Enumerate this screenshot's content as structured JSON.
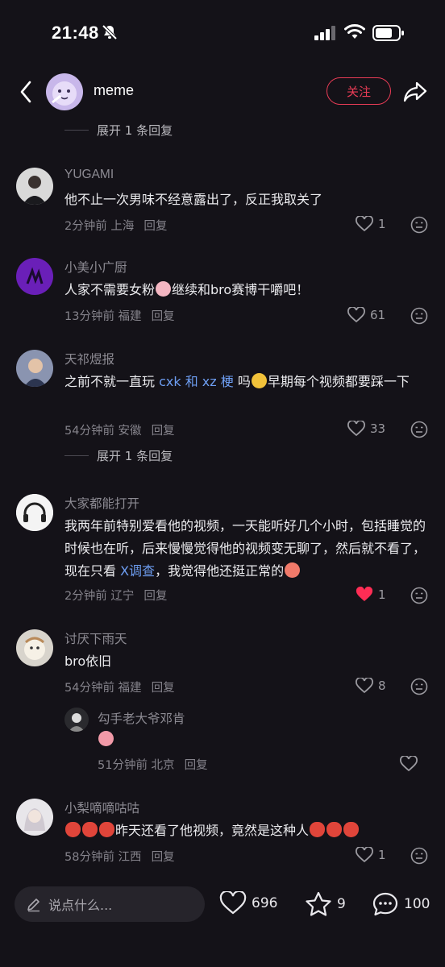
{
  "status": {
    "time": "21:48"
  },
  "header": {
    "username": "meme",
    "follow_label": "关注"
  },
  "expand_top": "展开 1 条回复",
  "expand_mid": "展开 1 条回复",
  "comments": [
    {
      "user": "YUGAMI",
      "text": "他不止一次男味不经意露出了，反正我取关了",
      "time": "2分钟前 上海",
      "reply": "回复",
      "likes": "1"
    },
    {
      "user": "小美小广厨",
      "text_a": "人家不需要女粉",
      "text_b": "继续和bro赛博干嚼吧！",
      "time": "13分钟前 福建",
      "reply": "回复",
      "likes": "61"
    },
    {
      "user": "天祁煜报",
      "text_a": "之前不就一直玩 ",
      "link": "cxk 和 xz 梗",
      "text_b": " 吗",
      "text_c": "早期每个视频都要踩一下",
      "time": "54分钟前 安徽",
      "reply": "回复",
      "likes": "33"
    },
    {
      "user": "大家都能打开",
      "text_a": "我两年前特别爱看他的视频，一天能听好几个小时，包括睡觉的时候也在听，后来慢慢觉得他的视频变无聊了，然后就不看了，现在只看 ",
      "link": "X调查",
      "text_b": "，我觉得他还挺正常的",
      "time": "2分钟前 辽宁",
      "reply": "回复",
      "likes": "1"
    },
    {
      "user": "讨厌下雨天",
      "text": "bro依旧",
      "time": "54分钟前 福建",
      "reply": "回复",
      "likes": "8"
    },
    {
      "user": "勾手老大爷邓肯",
      "time": "51分钟前 北京",
      "reply": "回复"
    },
    {
      "user": "小梨嘀嘀咕咕",
      "text": "昨天还看了他视频，竟然是这种人",
      "time": "58分钟前 江西",
      "reply": "回复",
      "likes": "1"
    }
  ],
  "bottom": {
    "placeholder": "说点什么...",
    "likes": "696",
    "stars": "9",
    "comments": "100"
  },
  "colors": {
    "accent": "#ea3c56",
    "link": "#6e9ef2",
    "liked": "#ff2d55"
  }
}
